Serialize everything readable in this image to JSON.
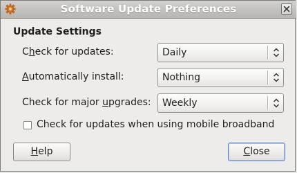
{
  "window": {
    "title": "Software Update Preferences",
    "app_icon": "gear-icon",
    "close_icon": "close-icon"
  },
  "section": {
    "heading": "Update Settings"
  },
  "settings": {
    "check_updates": {
      "label_pre": "C",
      "label_mnemonic": "h",
      "label_post": "eck for updates:",
      "value": "Daily"
    },
    "auto_install": {
      "label_pre": "",
      "label_mnemonic": "A",
      "label_post": "utomatically install:",
      "value": "Nothing"
    },
    "major_upgrades": {
      "label_pre": "Check for major ",
      "label_mnemonic": "u",
      "label_post": "pgrades:",
      "value": "Weekly"
    }
  },
  "mobile_broadband": {
    "label": "Check for updates when using mobile broadband",
    "checked": false
  },
  "buttons": {
    "help_mnemonic": "H",
    "help_rest": "elp",
    "close_mnemonic": "C",
    "close_rest": "lose"
  },
  "colors": {
    "window_bg": "#edeceb",
    "title_text": "#ffffff",
    "default_button_border": "#6a8cbc",
    "icon_orange": "#e07a1a"
  }
}
